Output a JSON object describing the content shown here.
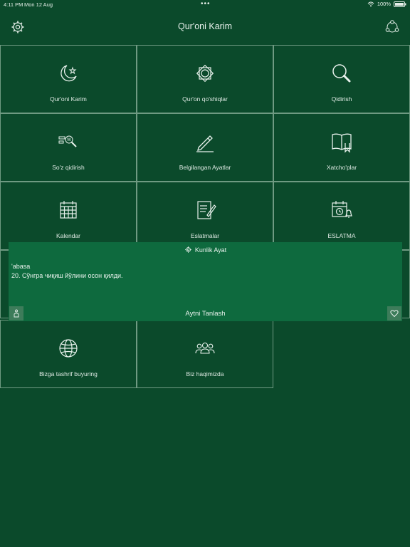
{
  "status_bar": {
    "time": "4:11 PM",
    "date": "Mon 12 Aug",
    "dots": "•••",
    "battery": "100%"
  },
  "nav": {
    "title": "Qur'oni Karim",
    "left_icon": "settings-gear-icon",
    "right_icon": "share-icon"
  },
  "tiles": [
    {
      "label": "Qur'oni Karim",
      "icon": "crescent-star-icon"
    },
    {
      "label": "Qur'on qo'shiqlar",
      "icon": "ornament-icon"
    },
    {
      "label": "Qidirish",
      "icon": "magnifier-icon"
    },
    {
      "label": "So'z qidirish",
      "icon": "word-search-icon"
    },
    {
      "label": "Belgilangan Ayatlar",
      "icon": "pencil-icon"
    },
    {
      "label": "Xatcho'plar",
      "icon": "book-bookmark-icon"
    },
    {
      "label": "Kalendar",
      "icon": "calendar-icon"
    },
    {
      "label": "Eslatmalar",
      "icon": "notes-icon"
    },
    {
      "label": "ESLATMA",
      "icon": "calendar-alarm-icon"
    },
    {
      "label": "Bizga tashrif buyuring",
      "icon": "globe-icon"
    },
    {
      "label": "Biz haqimizda",
      "icon": "people-icon"
    }
  ],
  "daily_ayat": {
    "title": "Kunlik Ayat",
    "surah": "'abasa",
    "verse": "20. Сўнгра чиқиш йўлини осон қилди.",
    "footer": "Aytni Tanlash"
  },
  "colors": {
    "background": "#0b4a2b",
    "panel": "#0e6a3e",
    "border": "#6f9a82"
  }
}
